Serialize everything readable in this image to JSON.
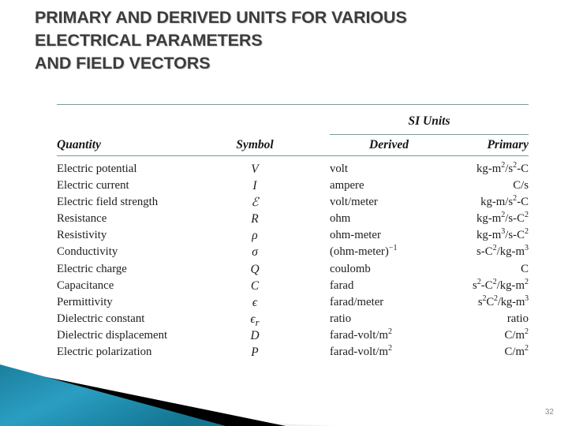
{
  "slide": {
    "title": "PRIMARY AND DERIVED UNITS FOR VARIOUS\nELECTRICAL PARAMETERS\nAND FIELD VECTORS",
    "page_number": "32",
    "title_color": "#3c3c3c",
    "rule_color": "#7c9a9a",
    "accent_teal": "#1f8fb4",
    "accent_pale": "#dde8ed",
    "accent_black": "#000000"
  },
  "table": {
    "group_header": "SI Units",
    "columns": [
      {
        "key": "quantity",
        "label": "Quantity"
      },
      {
        "key": "symbol",
        "label": "Symbol"
      },
      {
        "key": "derived",
        "label": "Derived"
      },
      {
        "key": "primary",
        "label": "Primary"
      }
    ],
    "rows": [
      {
        "quantity": "Electric potential",
        "symbol": "V",
        "derived": "volt",
        "primary": "kg-m2/s2-C",
        "primary_html": "kg-m<sup>2</sup>/s<sup>2</sup>-C"
      },
      {
        "quantity": "Electric current",
        "symbol": "I",
        "derived": "ampere",
        "primary": "C/s",
        "primary_html": "C/s"
      },
      {
        "quantity": "Electric field strength",
        "symbol": "ℰ",
        "derived": "volt/meter",
        "primary": "kg-m/s2-C",
        "primary_html": "kg-m/s<sup>2</sup>-C"
      },
      {
        "quantity": "Resistance",
        "symbol": "R",
        "derived": "ohm",
        "primary": "kg-m2/s-C2",
        "primary_html": "kg-m<sup>2</sup>/s-C<sup>2</sup>"
      },
      {
        "quantity": "Resistivity",
        "symbol": "ρ",
        "derived": "ohm-meter",
        "primary": "kg-m3/s-C2",
        "primary_html": "kg-m<sup>3</sup>/s-C<sup>2</sup>"
      },
      {
        "quantity": "Conductivity",
        "symbol": "σ",
        "derived": "(ohm-meter)-1",
        "derived_html": "(ohm-meter)<sup>−1</sup>",
        "primary": "s-C2/kg-m3",
        "primary_html": "s-C<sup>2</sup>/kg-m<sup>3</sup>"
      },
      {
        "quantity": "Electric charge",
        "symbol": "Q",
        "derived": "coulomb",
        "primary": "C",
        "primary_html": "C"
      },
      {
        "quantity": "Capacitance",
        "symbol": "C",
        "derived": "farad",
        "primary": "s2-C2/kg-m2",
        "primary_html": "s<sup>2</sup>-C<sup>2</sup>/kg-m<sup>2</sup>"
      },
      {
        "quantity": "Permittivity",
        "symbol": "ϵ",
        "derived": "farad/meter",
        "primary": "s2C2/kg-m3",
        "primary_html": "s<sup>2</sup>C<sup>2</sup>/kg-m<sup>3</sup>"
      },
      {
        "quantity": "Dielectric constant",
        "symbol": "ϵr",
        "symbol_html": "ϵ<sub>r</sub>",
        "derived": "ratio",
        "primary": "ratio",
        "primary_html": "ratio"
      },
      {
        "quantity": "Dielectric displacement",
        "symbol": "D",
        "derived": "farad-volt/m2",
        "derived_html": "farad-volt/m<sup>2</sup>",
        "primary": "C/m2",
        "primary_html": "C/m<sup>2</sup>"
      },
      {
        "quantity": "Electric polarization",
        "symbol": "P",
        "derived": "farad-volt/m2",
        "derived_html": "farad-volt/m<sup>2</sup>",
        "primary": "C/m2",
        "primary_html": "C/m<sup>2</sup>"
      }
    ]
  }
}
